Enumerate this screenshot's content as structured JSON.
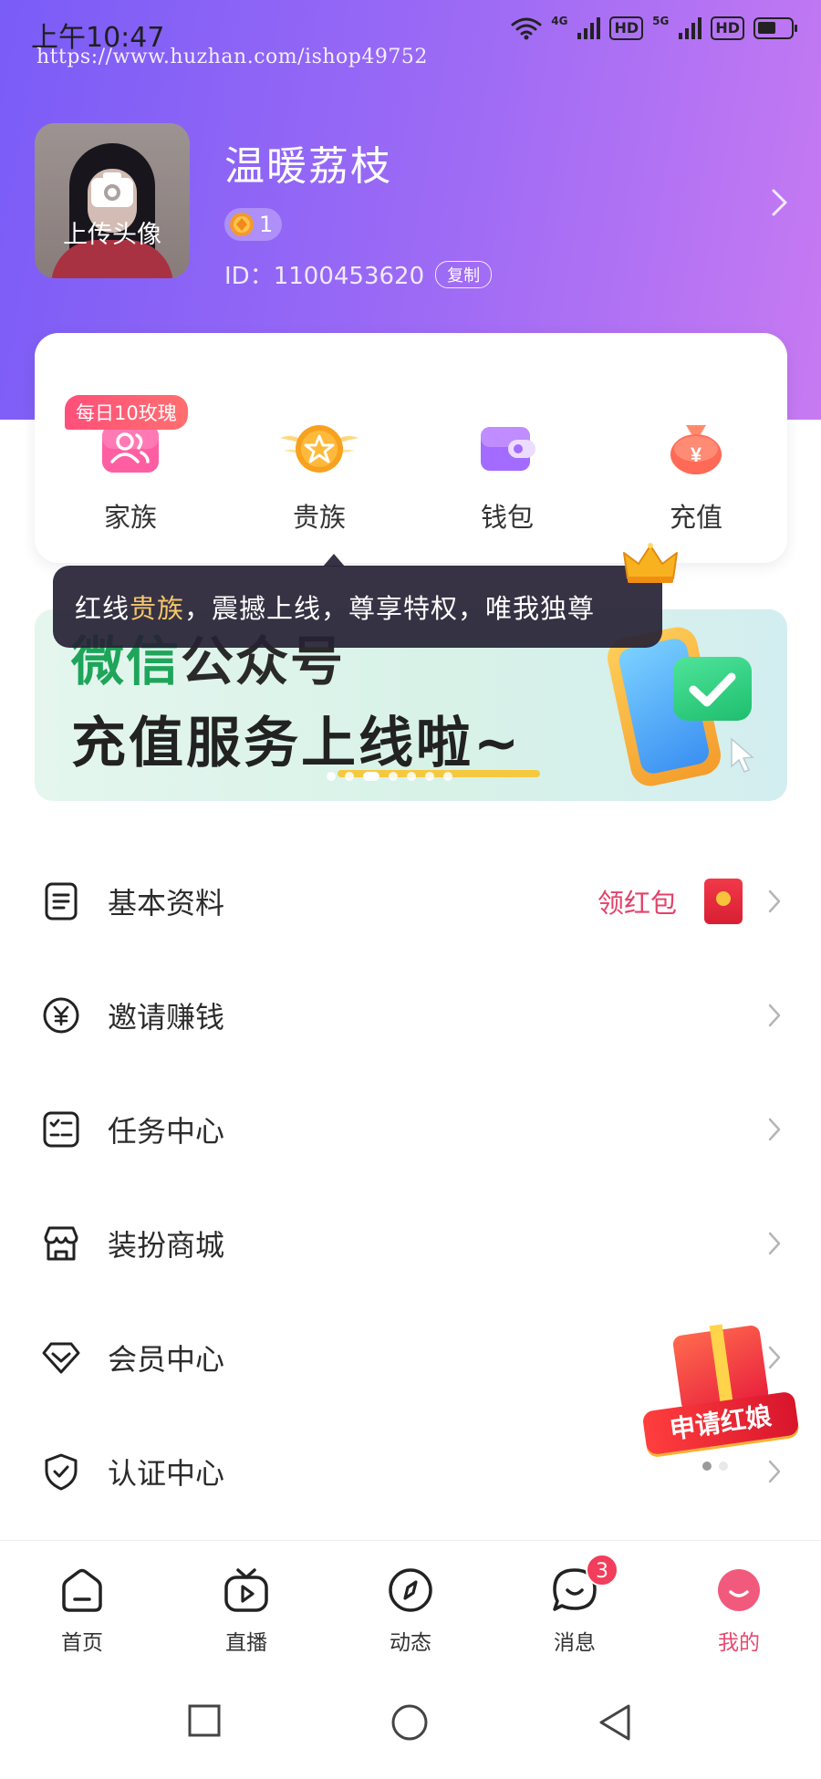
{
  "status_bar": {
    "time": "上午10:47",
    "watermark": "https://www.huzhan.com/ishop49752",
    "net1": "4G",
    "net2": "5G",
    "hd1": "HD",
    "hd2": "HD",
    "battery_level": 0.55
  },
  "profile": {
    "avatar_label": "上传头像",
    "username": "温暖荔枝",
    "level": "1",
    "user_id": "ID：1100453620",
    "copy_label": "复制"
  },
  "actions": {
    "daily_tag": "每日10玫瑰",
    "items": [
      {
        "label": "家族",
        "icon": "family-icon"
      },
      {
        "label": "贵族",
        "icon": "noble-icon"
      },
      {
        "label": "钱包",
        "icon": "wallet-icon"
      },
      {
        "label": "充值",
        "icon": "recharge-icon"
      }
    ]
  },
  "tooltip": {
    "prefix": "红线",
    "highlight": "贵族",
    "suffix": "，震撼上线，尊享特权，唯我独尊"
  },
  "banner": {
    "line1_green": "微信",
    "line1_dark": "公众号",
    "line2": "充值服务上线啦~"
  },
  "menu": {
    "items": [
      {
        "label": "基本资料",
        "icon": "document-icon"
      },
      {
        "label": "邀请赚钱",
        "icon": "yuan-coin-icon"
      },
      {
        "label": "任务中心",
        "icon": "checklist-icon"
      },
      {
        "label": "装扮商城",
        "icon": "store-icon"
      },
      {
        "label": "会员中心",
        "icon": "diamond-icon"
      },
      {
        "label": "认证中心",
        "icon": "shield-check-icon"
      }
    ],
    "red_packet_label": "领红包"
  },
  "promo": {
    "label": "申请红娘"
  },
  "bottom_nav": {
    "items": [
      {
        "label": "首页"
      },
      {
        "label": "直播"
      },
      {
        "label": "动态"
      },
      {
        "label": "消息",
        "badge": "3"
      },
      {
        "label": "我的"
      }
    ],
    "active": "我的"
  },
  "colors": {
    "header_gradient_start": "#7a5cf7",
    "header_gradient_end": "#c77af2",
    "accent_pink": "#e64a70",
    "badge_red": "#f23d5c"
  }
}
